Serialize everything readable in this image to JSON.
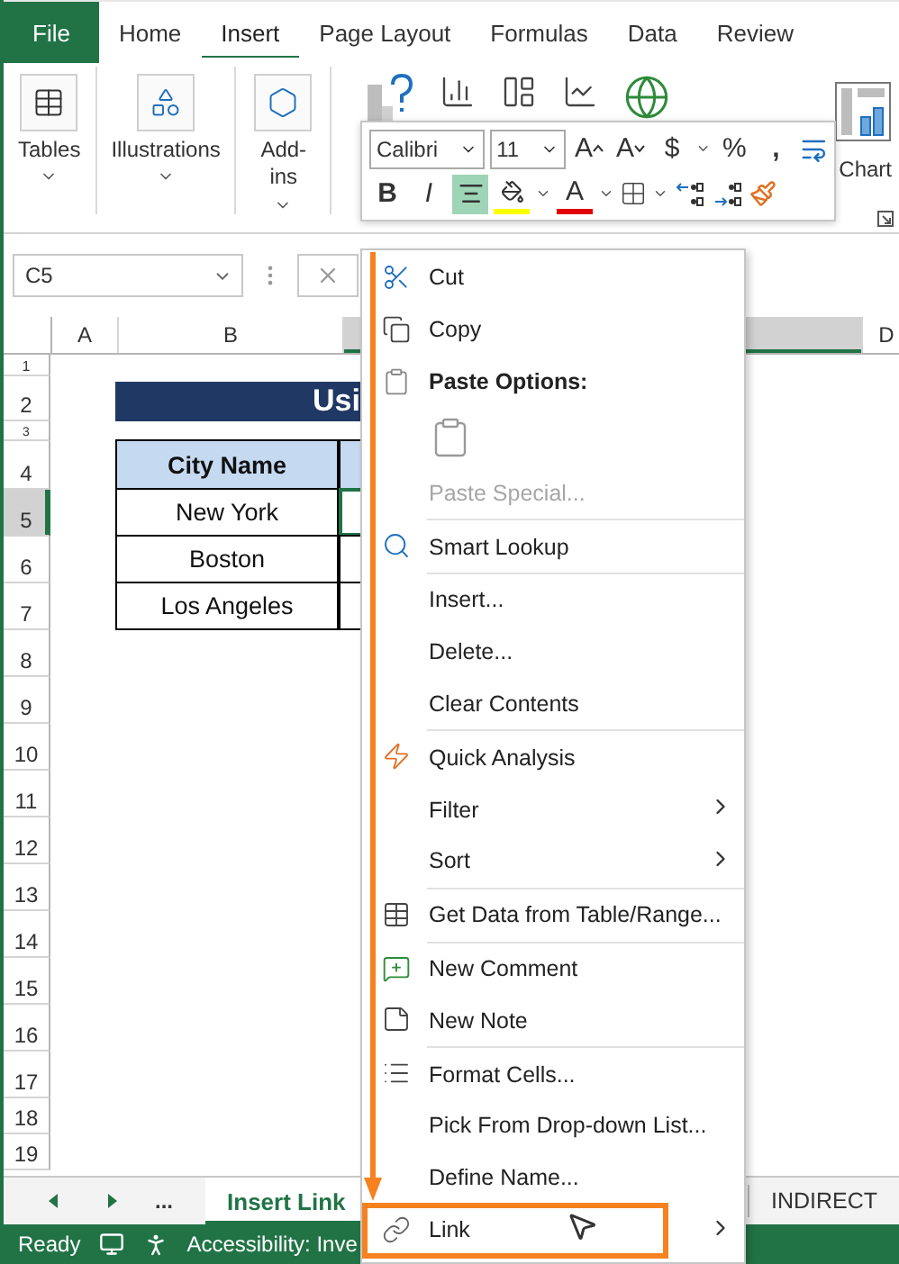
{
  "ribbon_tabs": [
    {
      "label": "File",
      "kind": "file",
      "selected": false
    },
    {
      "label": "Home",
      "kind": "tab",
      "selected": false
    },
    {
      "label": "Insert",
      "kind": "tab",
      "selected": true
    },
    {
      "label": "Page Layout",
      "kind": "tab",
      "selected": false
    },
    {
      "label": "Formulas",
      "kind": "tab",
      "selected": false
    },
    {
      "label": "Data",
      "kind": "tab",
      "selected": false
    },
    {
      "label": "Review",
      "kind": "tab",
      "selected": false
    }
  ],
  "ribbon_groups": [
    {
      "label": "Tables"
    },
    {
      "label": "Illustrations"
    },
    {
      "label": "Add-ins"
    }
  ],
  "chart_label": "Chart",
  "mini_toolbar": {
    "font": "Calibri",
    "size": "11",
    "grow_label": "A",
    "shrink_label": "A",
    "currency": "$",
    "percent": "%",
    "comma": ",",
    "bold": "B",
    "italic": "I",
    "font_color_label": "A",
    "center_selected": true
  },
  "name_box": "C5",
  "columns": [
    {
      "label": "A",
      "selected": false
    },
    {
      "label": "B",
      "selected": false
    },
    {
      "selected": true
    },
    {
      "label": "D",
      "selected": false
    }
  ],
  "rows": [
    {
      "number": "1",
      "kind": "blank",
      "selected": false
    },
    {
      "number": "2",
      "kind": "title",
      "cells": [
        "Usi"
      ],
      "selected": false
    },
    {
      "number": "3",
      "kind": "blank",
      "selected": false
    },
    {
      "number": "4",
      "kind": "header",
      "cells": [
        "City Name"
      ],
      "selected": false
    },
    {
      "number": "5",
      "kind": "data",
      "cells": [
        "New York"
      ],
      "selected": true
    },
    {
      "number": "6",
      "kind": "data",
      "cells": [
        "Boston"
      ],
      "selected": false
    },
    {
      "number": "7",
      "kind": "data",
      "cells": [
        "Los Angeles"
      ],
      "selected": false
    },
    {
      "number": "8",
      "kind": "blank",
      "selected": false
    },
    {
      "number": "9",
      "kind": "blank",
      "selected": false
    },
    {
      "number": "10",
      "kind": "blank",
      "selected": false
    },
    {
      "number": "11",
      "kind": "blank",
      "selected": false
    },
    {
      "number": "12",
      "kind": "blank",
      "selected": false
    },
    {
      "number": "13",
      "kind": "blank",
      "selected": false
    },
    {
      "number": "14",
      "kind": "blank",
      "selected": false
    },
    {
      "number": "15",
      "kind": "blank",
      "selected": false
    },
    {
      "number": "16",
      "kind": "blank",
      "selected": false
    },
    {
      "number": "17",
      "kind": "blank",
      "selected": false
    },
    {
      "number": "18",
      "kind": "blank",
      "selected": false
    },
    {
      "number": "19",
      "kind": "blank",
      "selected": false
    }
  ],
  "context_menu": [
    {
      "kind": "item",
      "label": "Cut",
      "disabled": false,
      "submenu": false
    },
    {
      "kind": "item",
      "label": "Copy",
      "disabled": false,
      "submenu": false
    },
    {
      "kind": "header",
      "label": "Paste Options:"
    },
    {
      "kind": "paste-options"
    },
    {
      "kind": "item",
      "label": "Paste Special...",
      "disabled": true,
      "submenu": false
    },
    {
      "kind": "separator"
    },
    {
      "kind": "item",
      "label": "Smart Lookup",
      "disabled": false,
      "submenu": false
    },
    {
      "kind": "separator"
    },
    {
      "kind": "item",
      "label": "Insert...",
      "disabled": false,
      "submenu": false
    },
    {
      "kind": "item",
      "label": "Delete...",
      "disabled": false,
      "submenu": false
    },
    {
      "kind": "item",
      "label": "Clear Contents",
      "disabled": false,
      "submenu": false
    },
    {
      "kind": "separator"
    },
    {
      "kind": "item",
      "label": "Quick Analysis",
      "disabled": false,
      "submenu": false
    },
    {
      "kind": "item",
      "label": "Filter",
      "disabled": false,
      "submenu": true
    },
    {
      "kind": "item",
      "label": "Sort",
      "disabled": false,
      "submenu": true
    },
    {
      "kind": "separator"
    },
    {
      "kind": "item",
      "label": "Get Data from Table/Range...",
      "disabled": false,
      "submenu": false
    },
    {
      "kind": "separator"
    },
    {
      "kind": "item",
      "label": "New Comment",
      "disabled": false,
      "submenu": false
    },
    {
      "kind": "item",
      "label": "New Note",
      "disabled": false,
      "submenu": false
    },
    {
      "kind": "separator"
    },
    {
      "kind": "item",
      "label": "Format Cells...",
      "disabled": false,
      "submenu": false
    },
    {
      "kind": "item",
      "label": "Pick From Drop-down List...",
      "disabled": false,
      "submenu": false
    },
    {
      "kind": "item",
      "label": "Define Name...",
      "disabled": false,
      "submenu": false
    },
    {
      "kind": "item",
      "label": "Link",
      "disabled": false,
      "submenu": true
    }
  ],
  "sheet_nav_more": "...",
  "sheet_tabs": [
    {
      "label": "Insert Link",
      "selected": true
    },
    {
      "label": "INDIRECT",
      "selected": false
    }
  ],
  "status": {
    "ready": "Ready",
    "accessibility": "Accessibility: Inve"
  }
}
